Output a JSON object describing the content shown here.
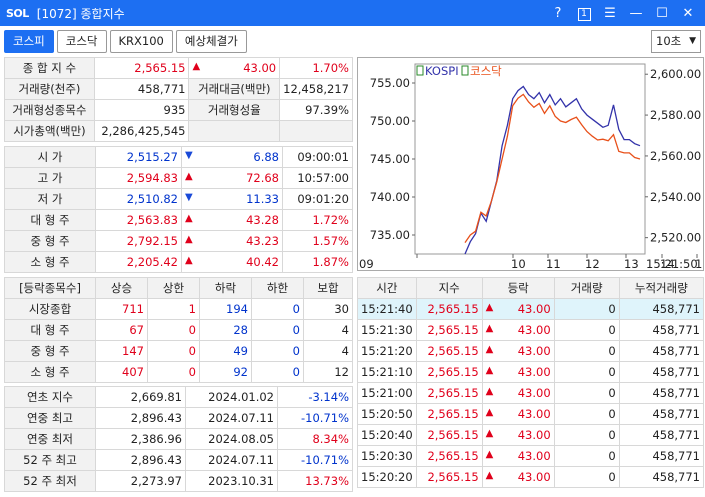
{
  "window": {
    "logo": "SOL",
    "title": "[1072] 종합지수",
    "help": "?",
    "box": "1",
    "menu": "☰",
    "min": "—",
    "max": "☐",
    "close": "✕"
  },
  "tabs": [
    "코스피",
    "코스닥",
    "KRX100",
    "예상체결가"
  ],
  "interval": "10초",
  "summary": {
    "index_label": "종 합 지 수",
    "index": "2,565.15",
    "index_chg": "43.00",
    "index_pct": "1.70%",
    "vol_label": "거래량(천주)",
    "vol": "458,771",
    "amt_label": "거래대금(백만)",
    "amt": "12,458,217",
    "form_label": "거래형성종목수",
    "form": "935",
    "rate_label": "거래형성율",
    "rate": "97.39%",
    "cap_label": "시가총액(백만)",
    "cap": "2,286,425,545"
  },
  "ohlc": [
    {
      "label": "시    가",
      "value": "2,515.27",
      "dir": "down",
      "chg": "6.88",
      "extra": "09:00:01"
    },
    {
      "label": "고    가",
      "value": "2,594.83",
      "dir": "up",
      "chg": "72.68",
      "extra": "10:57:00"
    },
    {
      "label": "저    가",
      "value": "2,510.82",
      "dir": "down",
      "chg": "11.33",
      "extra": "09:01:20"
    },
    {
      "label": "대 형 주",
      "value": "2,563.83",
      "dir": "up",
      "chg": "43.28",
      "extra": "1.72%"
    },
    {
      "label": "중 형 주",
      "value": "2,792.15",
      "dir": "up",
      "chg": "43.23",
      "extra": "1.57%"
    },
    {
      "label": "소 형 주",
      "value": "2,205.42",
      "dir": "up",
      "chg": "40.42",
      "extra": "1.87%"
    }
  ],
  "breadth": {
    "headers": [
      "[등락종목수]",
      "상승",
      "상한",
      "하락",
      "하한",
      "보합"
    ],
    "rows": [
      {
        "label": "시장종합",
        "v": [
          "711",
          "1",
          "194",
          "0",
          "30"
        ]
      },
      {
        "label": "대 형 주",
        "v": [
          "67",
          "0",
          "28",
          "0",
          "4"
        ]
      },
      {
        "label": "중 형 주",
        "v": [
          "147",
          "0",
          "49",
          "0",
          "4"
        ]
      },
      {
        "label": "소 형 주",
        "v": [
          "407",
          "0",
          "92",
          "0",
          "12"
        ]
      }
    ]
  },
  "history": [
    {
      "label": "연초  지수",
      "value": "2,669.81",
      "date": "2024.01.02",
      "pct": "-3.14%",
      "neg": true
    },
    {
      "label": "연중  최고",
      "value": "2,896.43",
      "date": "2024.07.11",
      "pct": "-10.71%",
      "neg": true
    },
    {
      "label": "연중  최저",
      "value": "2,386.96",
      "date": "2024.08.05",
      "pct": "8.34%",
      "neg": false
    },
    {
      "label": "52 주 최고",
      "value": "2,896.43",
      "date": "2024.07.11",
      "pct": "-10.71%",
      "neg": true
    },
    {
      "label": "52 주 최저",
      "value": "2,273.97",
      "date": "2023.10.31",
      "pct": "13.73%",
      "neg": false
    }
  ],
  "ticks": {
    "headers": [
      "시간",
      "지수",
      "등락",
      "거래량",
      "누적거래량"
    ],
    "rows": [
      {
        "time": "15:21:40",
        "idx": "2,565.15",
        "chg": "43.00",
        "vol": "0",
        "cum": "458,771"
      },
      {
        "time": "15:21:30",
        "idx": "2,565.15",
        "chg": "43.00",
        "vol": "0",
        "cum": "458,771"
      },
      {
        "time": "15:21:20",
        "idx": "2,565.15",
        "chg": "43.00",
        "vol": "0",
        "cum": "458,771"
      },
      {
        "time": "15:21:10",
        "idx": "2,565.15",
        "chg": "43.00",
        "vol": "0",
        "cum": "458,771"
      },
      {
        "time": "15:21:00",
        "idx": "2,565.15",
        "chg": "43.00",
        "vol": "0",
        "cum": "458,771"
      },
      {
        "time": "15:20:50",
        "idx": "2,565.15",
        "chg": "43.00",
        "vol": "0",
        "cum": "458,771"
      },
      {
        "time": "15:20:40",
        "idx": "2,565.15",
        "chg": "43.00",
        "vol": "0",
        "cum": "458,771"
      },
      {
        "time": "15:20:30",
        "idx": "2,565.15",
        "chg": "43.00",
        "vol": "0",
        "cum": "458,771"
      },
      {
        "time": "15:20:20",
        "idx": "2,565.15",
        "chg": "43.00",
        "vol": "0",
        "cum": "458,771"
      }
    ]
  },
  "chart_data": {
    "type": "line",
    "legend": [
      "KOSPI",
      "코스닥"
    ],
    "left_ticks": [
      "755.00",
      "750.00",
      "745.00",
      "740.00",
      "735.00"
    ],
    "right_ticks": [
      "2,600.00",
      "2,580.00",
      "2,560.00",
      "2,540.00",
      "2,520.00"
    ],
    "x_ticks": [
      "09",
      "10",
      "11",
      "12",
      "13",
      "14",
      "15",
      "15:21:50"
    ],
    "ylim_left": [
      732.5,
      757.5
    ],
    "ylim_right": [
      2512,
      2605
    ],
    "series": [
      {
        "name": "KOSPI",
        "axis": "right",
        "color": "#3333aa",
        "values": [
          2512,
          2518,
          2522,
          2532,
          2528,
          2538,
          2548,
          2565,
          2575,
          2588,
          2592,
          2594,
          2590,
          2588,
          2591,
          2586,
          2590,
          2585,
          2588,
          2584,
          2586,
          2588,
          2583,
          2580,
          2578,
          2576,
          2574,
          2575,
          2585,
          2573,
          2568,
          2568,
          2566,
          2565
        ]
      },
      {
        "name": "코스닥",
        "axis": "left",
        "color": "#e8501a",
        "values": [
          734,
          735,
          735.5,
          738,
          737.5,
          739.5,
          742,
          745,
          748,
          752,
          753,
          753.5,
          752.5,
          751.8,
          752.3,
          751,
          752,
          750.6,
          750,
          749.8,
          750.2,
          750.5,
          749.5,
          748.6,
          748,
          747.5,
          747.6,
          747.4,
          748.2,
          746,
          745.8,
          745.8,
          745.2,
          745
        ]
      }
    ]
  },
  "colors": {
    "accent": "#1d6ff2",
    "up": "#e0001b",
    "down": "#1a4ad8"
  }
}
